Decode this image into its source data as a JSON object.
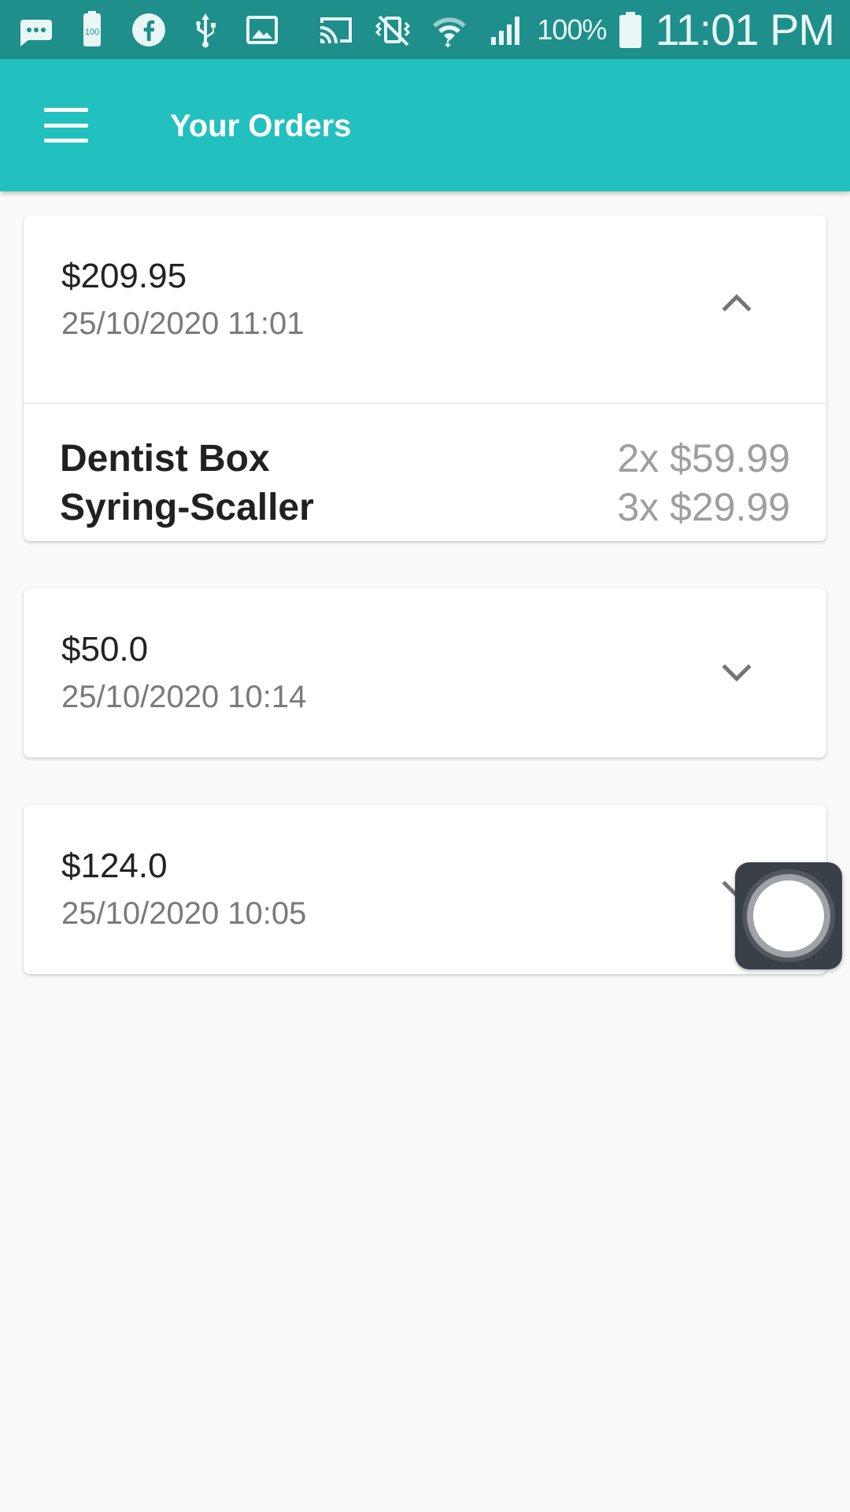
{
  "status_bar": {
    "icons": [
      "chat-icon",
      "battery-100-icon",
      "facebook-icon",
      "usb-icon",
      "image-icon",
      "cast-icon",
      "vibrate-off-icon",
      "wifi-icon",
      "signal-icon",
      "battery-icon"
    ],
    "battery_badge": "100",
    "battery_percent": "100%",
    "time": "11:01 PM"
  },
  "app_bar": {
    "title": "Your Orders",
    "icon": "menu-icon",
    "color": "#22c0bf"
  },
  "orders": [
    {
      "total": "$209.95",
      "date": "25/10/2020 11:01",
      "expanded": true,
      "items": [
        {
          "name": "Dentist Box",
          "qty_price": "2x $59.99"
        },
        {
          "name": "Syring-Scaller",
          "qty_price": "3x $29.99"
        }
      ]
    },
    {
      "total": "$50.0",
      "date": "25/10/2020 10:14",
      "expanded": false
    },
    {
      "total": "$124.0",
      "date": "25/10/2020 10:05",
      "expanded": false
    }
  ],
  "overlay": {
    "icon": "assistive-touch-icon"
  }
}
